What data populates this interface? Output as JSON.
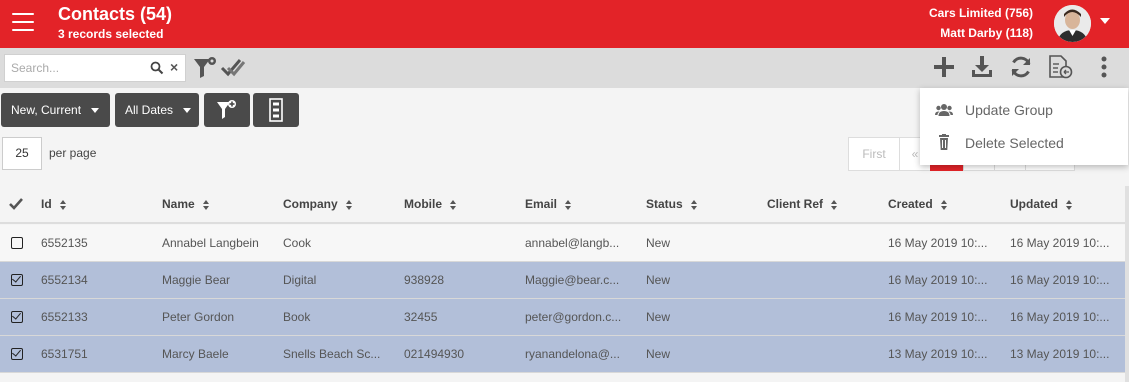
{
  "header": {
    "title": "Contacts (54)",
    "subtitle": "3 records selected",
    "account_company": "Cars Limited (756)",
    "account_user": "Matt Darby (118)"
  },
  "toolbar": {
    "search_placeholder": "Search...",
    "clear_label": "×"
  },
  "filters": {
    "status_filter": "New, Current",
    "date_filter": "All Dates"
  },
  "paging": {
    "per_page_value": "25",
    "per_page_label": "per page",
    "first_label": "First",
    "prev_label": "«"
  },
  "menu": {
    "items": [
      {
        "label": "Update Group",
        "icon": "group-icon"
      },
      {
        "label": "Delete Selected",
        "icon": "trash-icon"
      }
    ]
  },
  "table": {
    "columns": [
      "Id",
      "Name",
      "Company",
      "Mobile",
      "Email",
      "Status",
      "Client Ref",
      "Created",
      "Updated"
    ],
    "rows": [
      {
        "selected": false,
        "id": "6552135",
        "name": "Annabel Langbein",
        "company": "Cook",
        "mobile": "",
        "email": "annabel@langb...",
        "status": "New",
        "client_ref": "",
        "created": "16 May 2019 10:...",
        "updated": "16 May 2019 10:..."
      },
      {
        "selected": true,
        "id": "6552134",
        "name": "Maggie Bear",
        "company": "Digital",
        "mobile": "938928",
        "email": "Maggie@bear.c...",
        "status": "New",
        "client_ref": "",
        "created": "16 May 2019 10:...",
        "updated": "16 May 2019 10:..."
      },
      {
        "selected": true,
        "id": "6552133",
        "name": "Peter Gordon",
        "company": "Book",
        "mobile": "32455",
        "email": "peter@gordon.c...",
        "status": "New",
        "client_ref": "",
        "created": "16 May 2019 10:...",
        "updated": "16 May 2019 10:..."
      },
      {
        "selected": true,
        "id": "6531751",
        "name": "Marcy Baele",
        "company": "Snells Beach Sc...",
        "mobile": "021494930",
        "email": "ryanandelona@...",
        "status": "New",
        "client_ref": "",
        "created": "13 May 2019 10:...",
        "updated": "13 May 2019 10:..."
      }
    ]
  },
  "colors": {
    "brand_red": "#e32328",
    "selected_row": "#b2bfd9",
    "dark_button": "#4a4a4a"
  }
}
